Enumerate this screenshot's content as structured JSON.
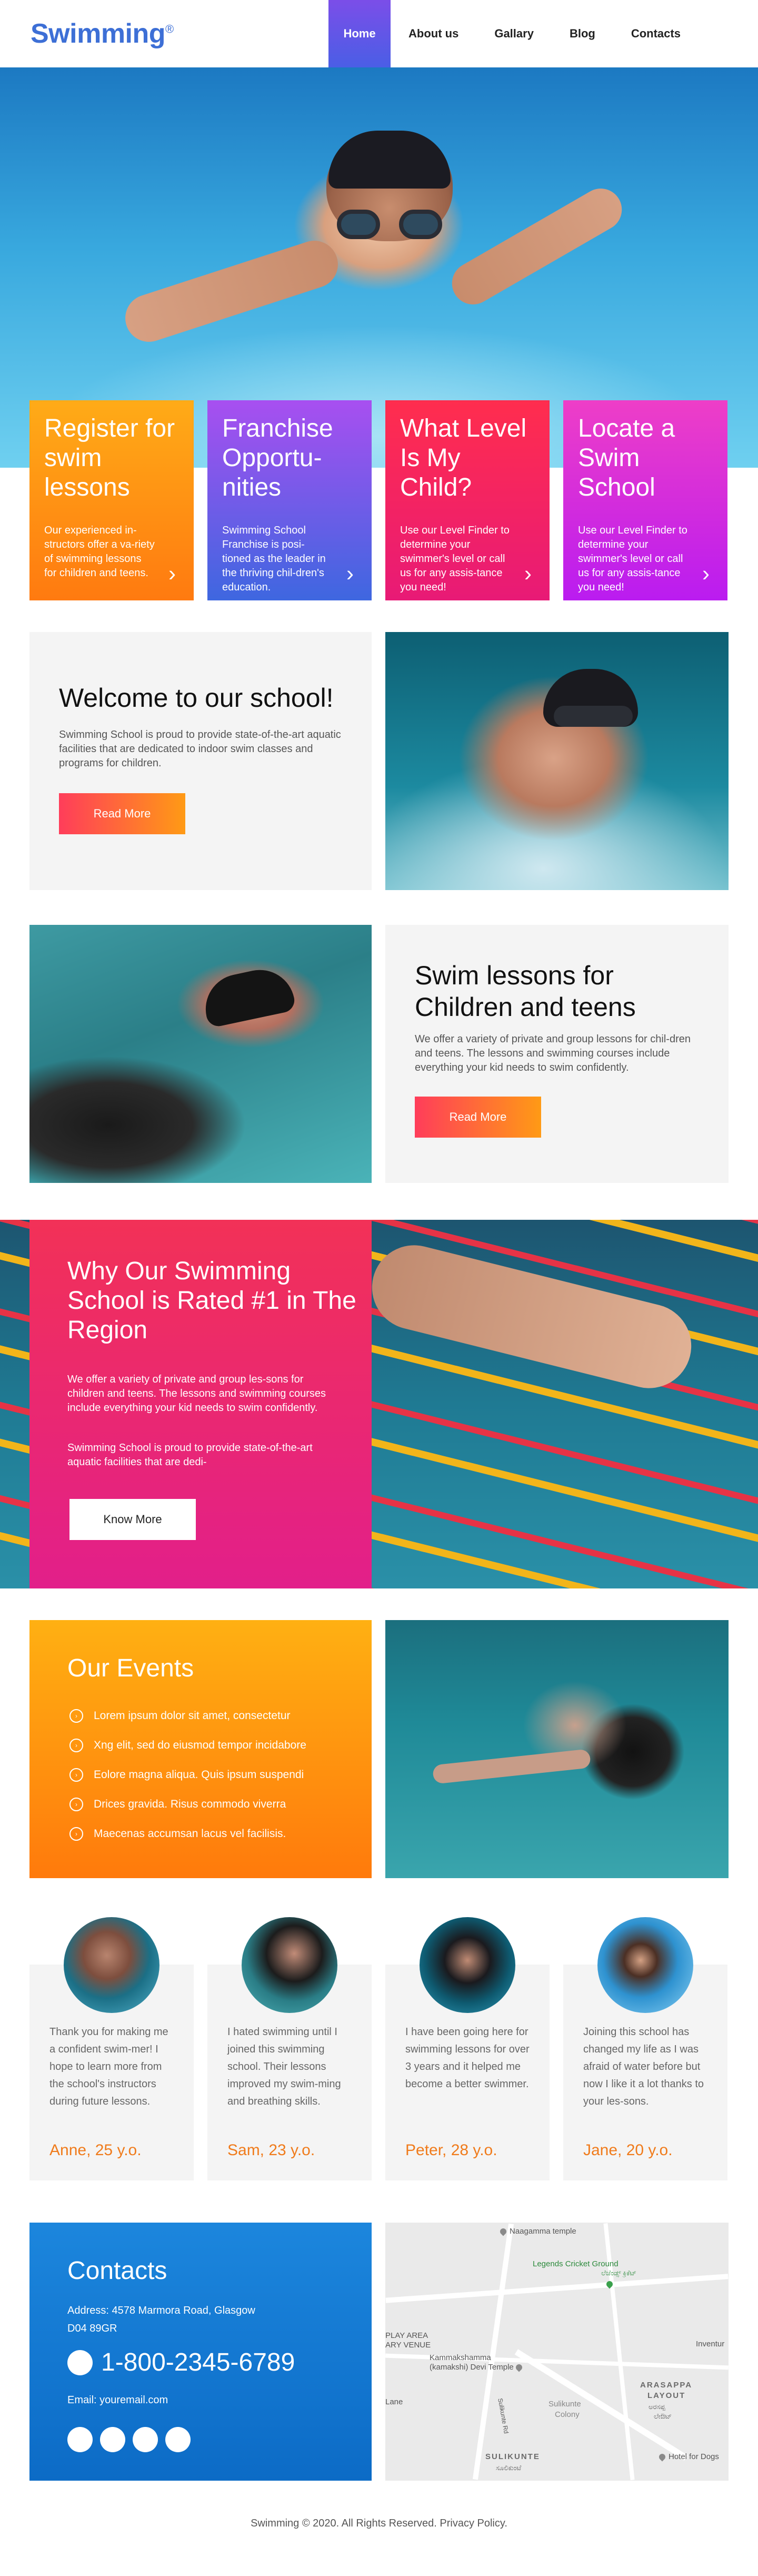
{
  "brand": {
    "logo": "Swimming",
    "logo_mark": "®"
  },
  "nav": {
    "items": [
      {
        "label": "Home"
      },
      {
        "label": "About us"
      },
      {
        "label": "Gallary"
      },
      {
        "label": "Blog"
      },
      {
        "label": "Contacts"
      }
    ],
    "active": "Home"
  },
  "features": [
    {
      "title": "Register for swim lessons",
      "text": "Our experienced in-structors offer a va-riety of swimming lessons for children and teens.",
      "icon": "chevron-right-icon"
    },
    {
      "title": "Franchise Opportu-nities",
      "text": "Swimming School Franchise is posi-tioned as the leader in the thriving chil-dren's education.",
      "icon": "chevron-right-icon"
    },
    {
      "title": "What Level Is My Child?",
      "text": "Use our Level Finder to determine your swimmer's level or call us for any assis-tance you need!",
      "icon": "chevron-right-icon"
    },
    {
      "title": "Locate a Swim School",
      "text": "Use our Level Finder to determine your swimmer's level or call us for any assis-tance you need!",
      "icon": "chevron-right-icon"
    }
  ],
  "welcome": {
    "title": "Welcome to our school!",
    "text": "Swimming School is proud to provide state-of-the-art aquatic facilities that are dedicated to indoor swim classes and programs for children.",
    "button": "Read More"
  },
  "lessons": {
    "title": "Swim lessons for Children and teens",
    "text": "We offer a variety of private and group lessons for chil-dren and teens. The lessons and swimming courses include everything your kid needs to swim confidently.",
    "button": "Read More"
  },
  "why": {
    "title": "Why Our Swimming School is Rated #1 in The Region",
    "text1": "We offer a variety of private and group les-sons for children and teens. The lessons and swimming courses include everything your kid needs to swim confidently.",
    "text2": "Swimming School is proud to provide state-of-the-art aquatic facilities that are dedi-",
    "button": "Know More"
  },
  "events": {
    "title": "Our Events",
    "items": [
      "Lorem ipsum dolor sit amet, consectetur",
      "Xng elit, sed do eiusmod tempor incidabore",
      "Eolore magna aliqua. Quis ipsum suspendi",
      "Drices gravida. Risus commodo viverra",
      "Maecenas accumsan lacus vel facilisis."
    ]
  },
  "testimonials": [
    {
      "text": "Thank you for making me a confident swim-mer! I hope to learn more from the school's instructors during future lessons.",
      "name": "Anne, 25 y.o."
    },
    {
      "text": "I hated swimming until I joined this swimming school. Their lessons improved my swim-ming and breathing skills.",
      "name": "Sam, 23 y.o."
    },
    {
      "text": "I have been going here for swimming lessons for over 3 years and it helped me become a better swimmer.",
      "name": "Peter, 28 y.o."
    },
    {
      "text": "Joining this school has changed my life as I was afraid of water before but now I like it a lot thanks to your les-sons.",
      "name": "Jane, 20 y.o."
    }
  ],
  "contacts": {
    "title": "Contacts",
    "address": "Address: 4578 Marmora Road, Glasgow D04 89GR",
    "phone": "1-800-2345-6789",
    "email": "Email: youremail.com"
  },
  "map": {
    "labels": {
      "naagamma": "Naagamma temple",
      "legends": "Legends Cricket Ground",
      "legends_kn": "ಲೆಜೆಂಡ್ಸ್ ಕ್ರಿಕೆಟ್",
      "playarea": "PLAY AREA",
      "playarea2": "ARY VENUE",
      "kammakshamma": "Kammakshamma",
      "kammakshamma2": "(kamakshi) Devi Temple",
      "inventure": "Inventur",
      "arasappa": "ARASAPPA",
      "layout": "LAYOUT",
      "arasappa_kn": "ಅರಸಪ್ಪ",
      "layout_kn": "ಲೇಔಟ್",
      "sulikunte_colony": "Sulikunte",
      "colony": "Colony",
      "sulikunte": "SULIKUNTE",
      "sulikunte_kn": "ಸೂಲಿಕುಂಟೆ",
      "hotel": "Hotel for Dogs",
      "lane": "Lane",
      "road": "Sulikunte Rd"
    }
  },
  "footer": {
    "text": "Swimming ©  2020. All Rights Reserved.  Privacy Policy."
  }
}
